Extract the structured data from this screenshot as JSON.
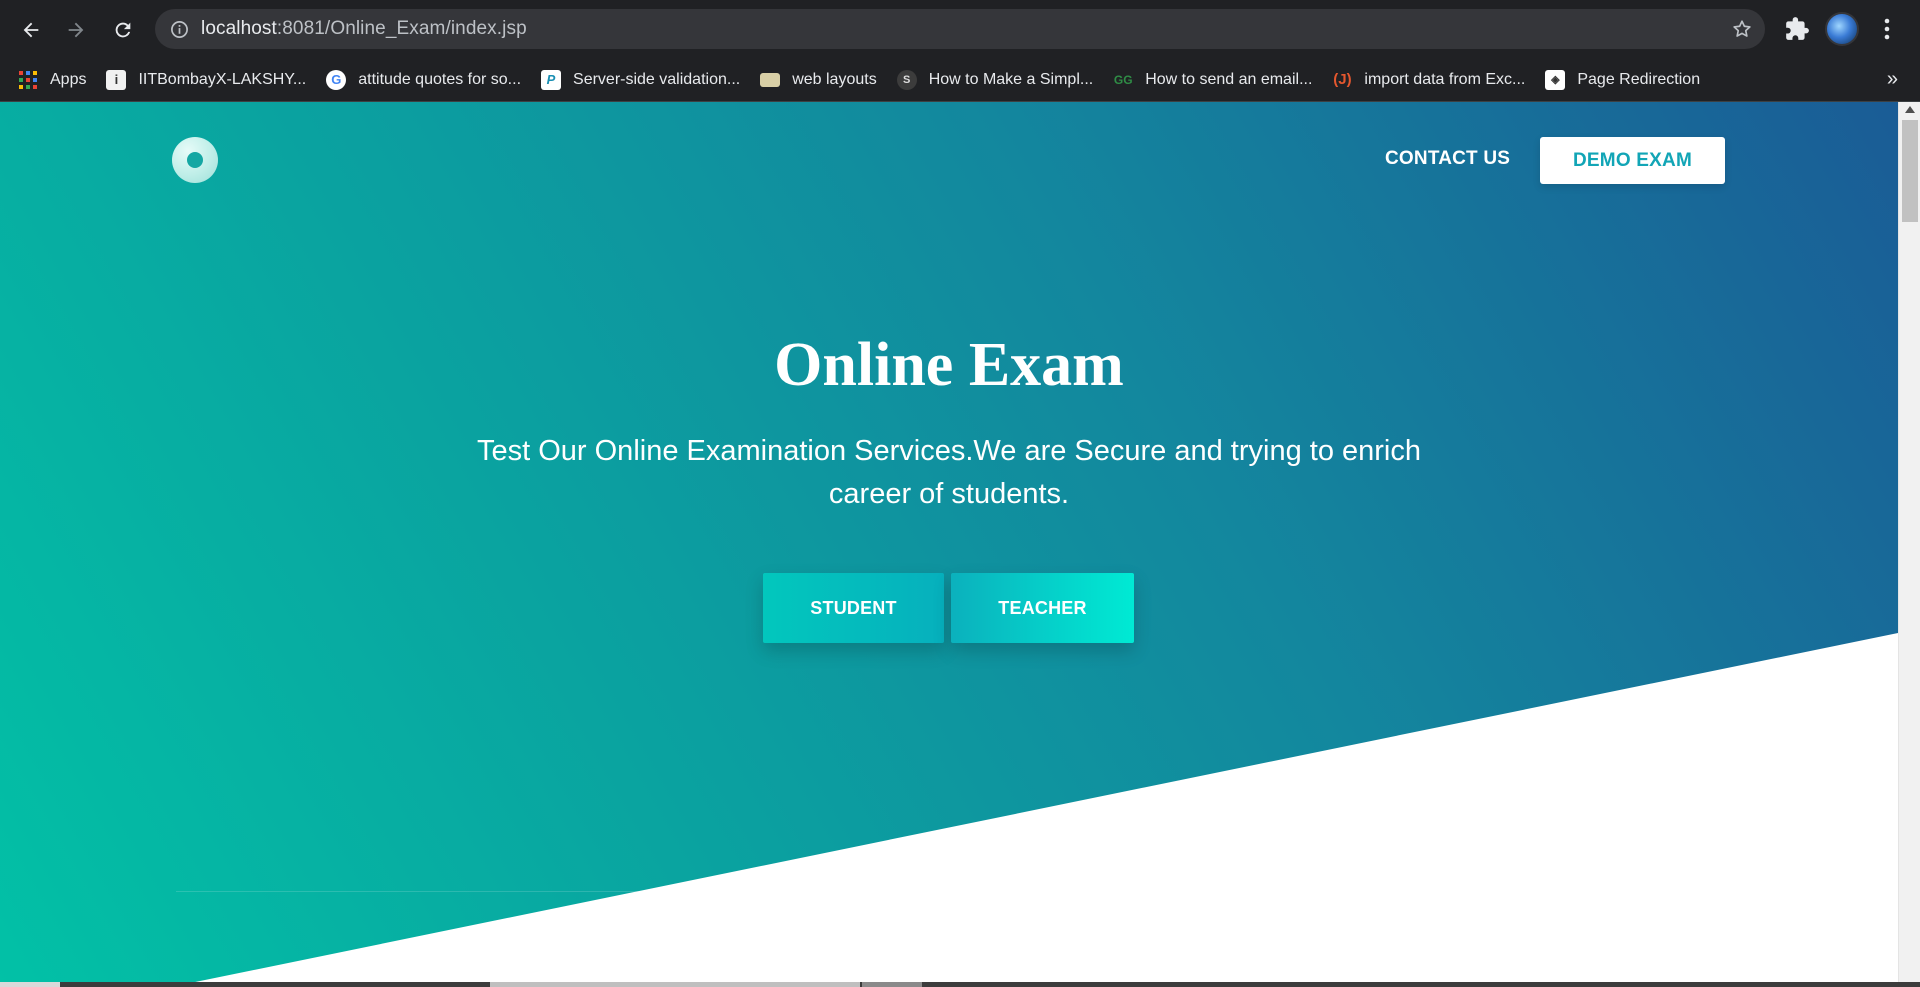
{
  "browser": {
    "url_host": "localhost",
    "url_rest": ":8081/Online_Exam/index.jsp",
    "bookmarks": [
      {
        "label": "Apps",
        "icon": "apps-grid-icon"
      },
      {
        "label": "IITBombayX-LAKSHY...",
        "icon": "iitbx-favicon"
      },
      {
        "label": "attitude quotes for so...",
        "icon": "google-favicon"
      },
      {
        "label": "Server-side validation...",
        "icon": "p-favicon"
      },
      {
        "label": "web layouts",
        "icon": "folder-favicon"
      },
      {
        "label": "How to Make a Simpl...",
        "icon": "dark-circle-favicon"
      },
      {
        "label": "How to send an email...",
        "icon": "gfg-favicon"
      },
      {
        "label": "import data from Exc...",
        "icon": "j-favicon"
      },
      {
        "label": "Page Redirection",
        "icon": "page-favicon"
      }
    ],
    "bookmarks_more": "»"
  },
  "nav": {
    "contact_label": "CONTACT US",
    "demo_label": "DEMO EXAM"
  },
  "hero": {
    "title": "Online Exam",
    "subtitle": "Test Our Online Examination Services.We are Secure and trying to enrich career of students.",
    "student_label": "STUDENT",
    "teacher_label": "TEACHER"
  },
  "colors": {
    "gradient_start": "#02c1a6",
    "gradient_end": "#1a5c96",
    "demo_text": "#12a5b6",
    "student_btn": "#02c7bd",
    "teacher_btn": "#00ead4"
  }
}
